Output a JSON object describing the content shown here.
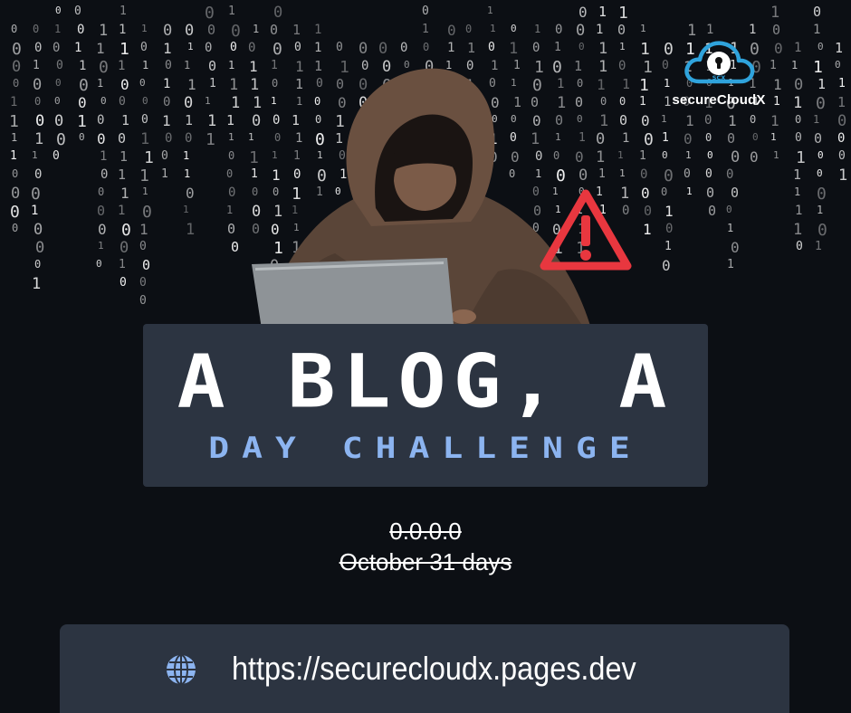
{
  "logo": {
    "badge_text": "SCX",
    "name": "secureCloudX"
  },
  "headline": {
    "title": "A BLOG, A",
    "subtitle": "DAY CHALLENGE"
  },
  "details": {
    "version": "0.0.0.0",
    "period": "October  31 days"
  },
  "website": {
    "url": "https://securecloudx.pages.dev"
  },
  "colors": {
    "background": "#0c0f14",
    "panel": "#2c3441",
    "accent": "#8cb4f0",
    "warning": "#e8373f",
    "logo_cloud": "#2fa3dc"
  },
  "icons": [
    "binary-rain",
    "hooded-hacker",
    "laptop",
    "warning-icon",
    "cloud-lock-logo",
    "globe-icon"
  ],
  "binary_digits": [
    "0",
    "1"
  ]
}
